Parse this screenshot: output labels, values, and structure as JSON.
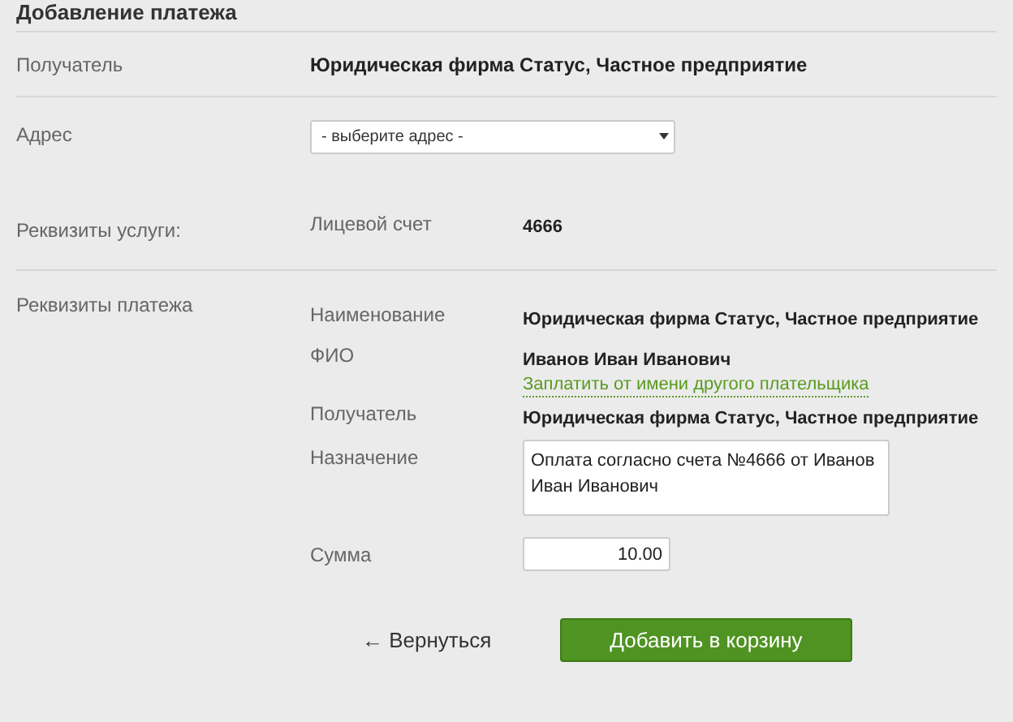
{
  "title": "Добавление платежа",
  "recipient": {
    "label": "Получатель",
    "value": "Юридическая фирма Статус, Частное предприятие"
  },
  "address": {
    "label": "Адрес",
    "select_value": "- выберите адрес -"
  },
  "service": {
    "label": "Реквизиты услуги:",
    "field_label": "Лицевой счет",
    "field_value": "4666"
  },
  "payment": {
    "label": "Реквизиты платежа",
    "fields": [
      {
        "kind": "text",
        "label": "Наименование",
        "value": "Юридическая фирма Статус, Частное предприятие"
      },
      {
        "kind": "text",
        "label": "ФИО",
        "value": "Иванов Иван Иванович",
        "link": "Заплатить от имени другого плательщика"
      },
      {
        "kind": "text",
        "label": "Получатель",
        "value": "Юридическая фирма Статус, Частное предприятие"
      },
      {
        "kind": "textarea",
        "label": "Назначение",
        "value": "Оплата согласно счета №4666 от Иванов Иван Иванович"
      },
      {
        "kind": "input",
        "label": "Сумма",
        "value": "10.00"
      }
    ]
  },
  "back_link": "← Вернуться",
  "submit_button": "Добавить в корзину"
}
